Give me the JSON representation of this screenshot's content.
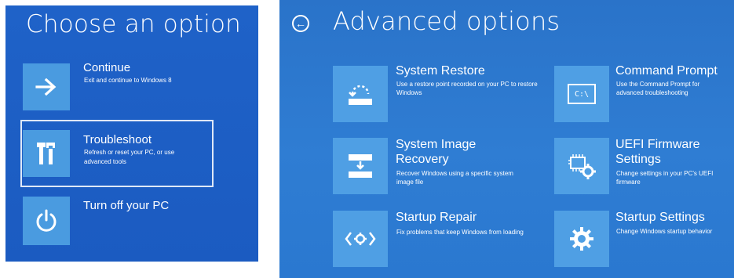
{
  "choose": {
    "title": "Choose an option",
    "options": [
      {
        "label": "Continue",
        "desc": "Exit and continue to Windows 8",
        "icon": "arrow-right-icon"
      },
      {
        "label": "Troubleshoot",
        "desc": "Refresh or reset your PC, or use advanced tools",
        "icon": "tools-icon"
      },
      {
        "label": "Turn off your PC",
        "desc": "",
        "icon": "power-icon"
      }
    ]
  },
  "advanced": {
    "title": "Advanced options",
    "back_icon": "back-arrow-icon",
    "options": [
      {
        "label": "System Restore",
        "desc": "Use a restore point recorded on your PC to restore Windows",
        "icon": "system-restore-icon"
      },
      {
        "label": "Command Prompt",
        "desc": "Use the Command Prompt for advanced troubleshooting",
        "icon": "command-prompt-icon",
        "icon_text": "C:\\"
      },
      {
        "label": "System Image Recovery",
        "desc": "Recover Windows using a specific system image file",
        "icon": "system-image-icon"
      },
      {
        "label": "UEFI Firmware Settings",
        "desc": "Change settings in your PC's UEFI firmware",
        "icon": "uefi-chip-icon"
      },
      {
        "label": "Startup Repair",
        "desc": "Fix problems that keep Windows from loading",
        "icon": "startup-repair-icon"
      },
      {
        "label": "Startup Settings",
        "desc": "Change Windows startup behavior",
        "icon": "gear-icon"
      }
    ]
  },
  "colors": {
    "left_bg": "#1f62c8",
    "right_bg": "#2a73c9",
    "tile": "#4a9be0",
    "text": "#ffffff"
  }
}
